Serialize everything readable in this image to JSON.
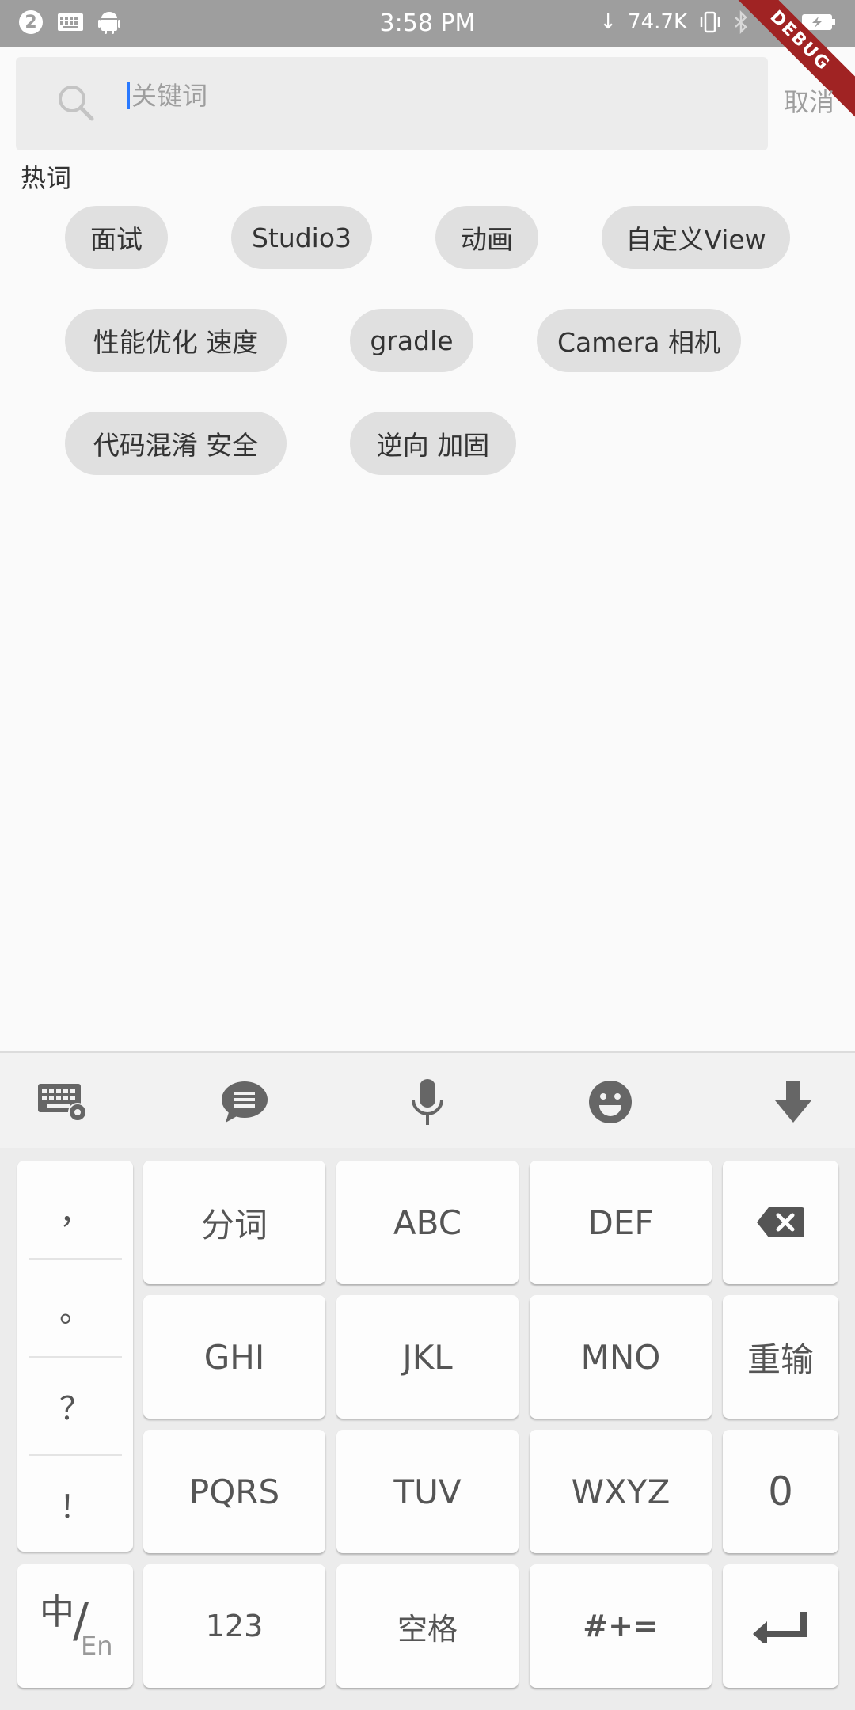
{
  "status_bar": {
    "notification_count": "2",
    "time": "3:58 PM",
    "net_speed": "74.7K",
    "debug_label": "DEBUG"
  },
  "search": {
    "placeholder": "关键词",
    "cancel_label": "取消"
  },
  "hot_words": {
    "title": "热词",
    "chips": [
      "面试",
      "Studio3",
      "动画",
      "自定义View",
      "性能优化 速度",
      "gradle",
      "Camera 相机",
      "代码混淆 安全",
      "逆向 加固"
    ]
  },
  "keyboard": {
    "toolbar_icons": [
      "keyboard-settings-icon",
      "message-icon",
      "microphone-icon",
      "emoji-icon",
      "collapse-down-icon"
    ],
    "punctuation": [
      "，",
      "。",
      "？",
      "！"
    ],
    "row1": [
      "分词",
      "ABC",
      "DEF"
    ],
    "row2": [
      "GHI",
      "JKL",
      "MNO",
      "重输"
    ],
    "row3": [
      "PQRS",
      "TUV",
      "WXYZ",
      "0"
    ],
    "lang_switch": {
      "main": "中",
      "sub": "En"
    },
    "row4": [
      "123",
      "空格",
      "#+="
    ],
    "backspace_icon": "backspace-icon",
    "enter_icon": "enter-icon"
  },
  "colors": {
    "status_bar": "#9e9e9e",
    "chip_bg": "#e0e0e0",
    "caret": "#2979ff",
    "debug_ribbon": "#a02323"
  }
}
